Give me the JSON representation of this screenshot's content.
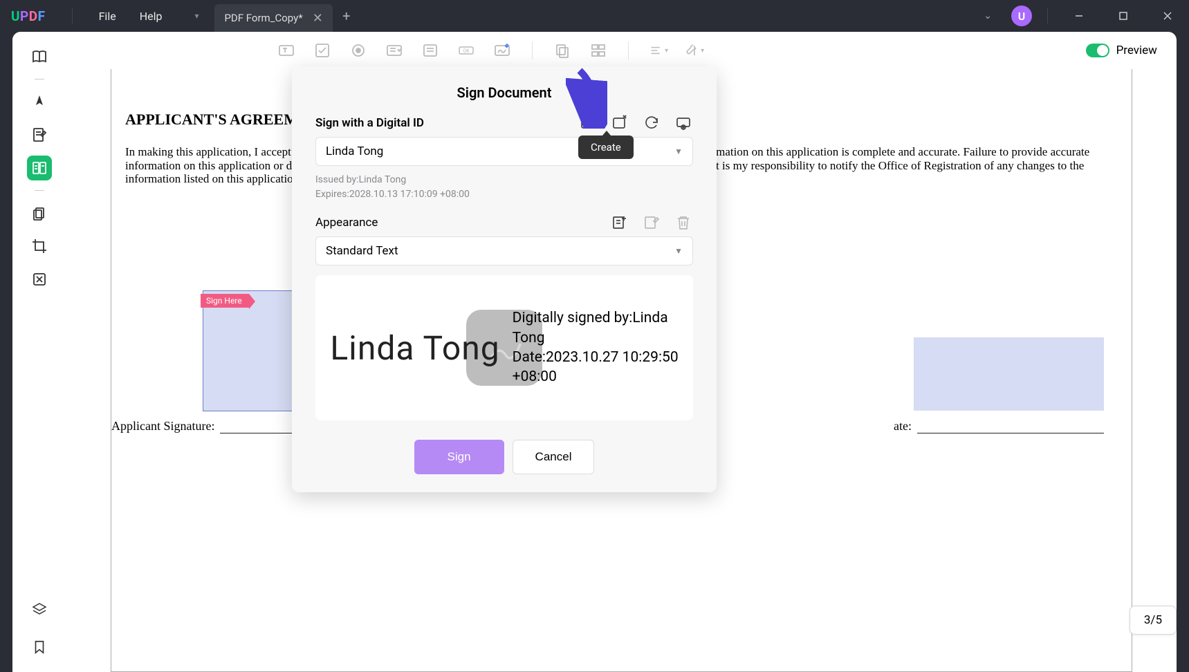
{
  "app": {
    "logo_u": "U",
    "logo_p": "P",
    "logo_d": "D",
    "logo_f": "F"
  },
  "menu": {
    "file": "File",
    "help": "Help"
  },
  "tab": {
    "title": "PDF Form_Copy*"
  },
  "preview_label": "Preview",
  "document": {
    "heading": "APPLICANT'S AGREEMEN",
    "paragraph": "In making this application, I accept and agree to abide by the policies and rules of Religious College, and affirm that the information on this application is complete and accurate. Failure to provide accurate information on this application or deliberate omissions will be cause for denial or admission to the college. I understand that it is my responsibility to notify the Office of Registration of any changes to the information listed on this application.",
    "sign_here": "Sign Here",
    "applicant_signature": "Applicant Signature:",
    "date_suffix": "ate:"
  },
  "modal": {
    "title": "Sign Document",
    "sign_with_label": "Sign with a Digital ID",
    "id_name": "Linda Tong",
    "issued_label": "Issued by:",
    "issued_value": "Linda Tong",
    "expires_label": "Expires:",
    "expires_value": "2028.10.13 17:10:09 +08:00",
    "appearance_label": "Appearance",
    "appearance_value": "Standard Text",
    "preview_name": "Linda Tong",
    "preview_signed_by": "Digitally signed by:Linda Tong",
    "preview_date": "Date:2023.10.27 10:29:50 +08:00",
    "sign_button": "Sign",
    "cancel_button": "Cancel",
    "tooltip_create": "Create"
  },
  "page_counter": "3/5"
}
